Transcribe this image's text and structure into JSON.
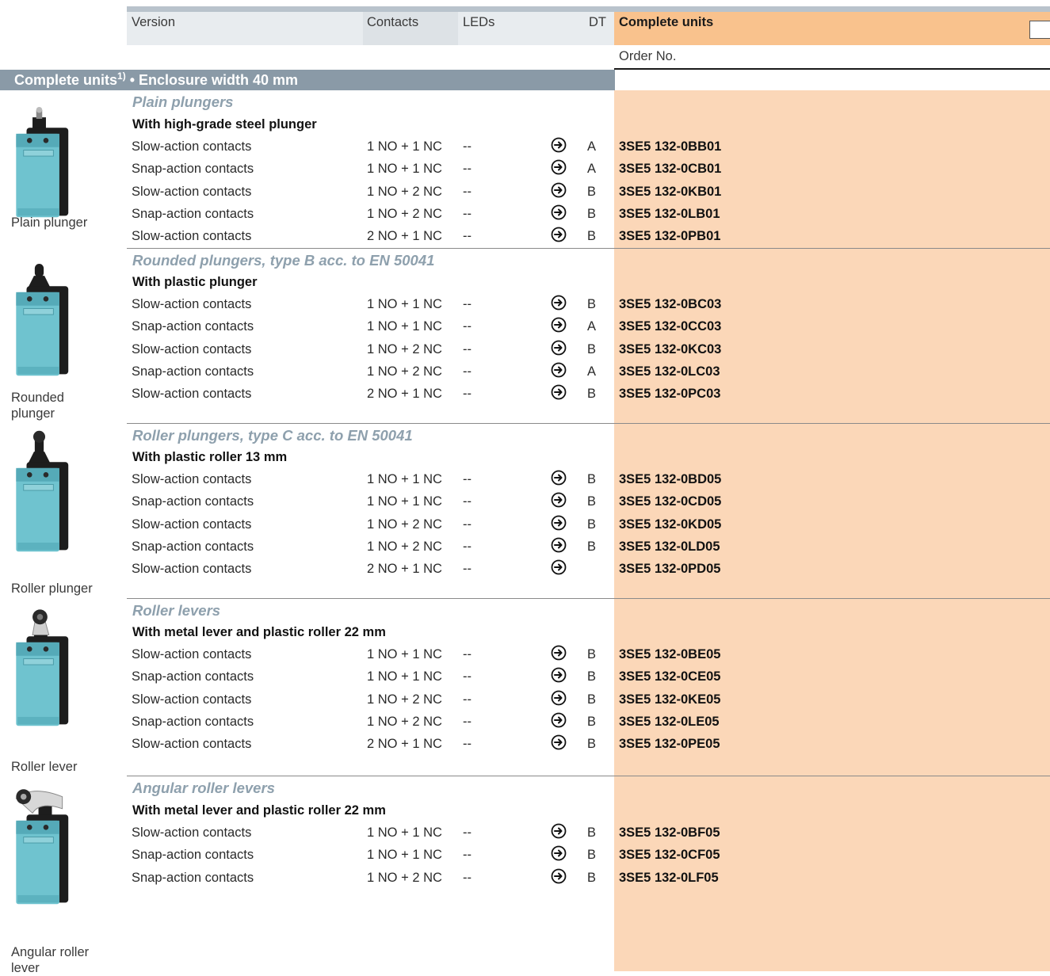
{
  "header": {
    "version": "Version",
    "contacts": "Contacts",
    "leds": "LEDs",
    "dt": "DT",
    "complete_units": "Complete units",
    "order_no": "Order No."
  },
  "section": {
    "title": "Complete units",
    "footnote": "1)",
    "suffix": " • Enclosure width 40 mm"
  },
  "colors": {
    "accent_orange": "#f9c28d",
    "order_bg": "#fbd7b8",
    "section_bg": "#8a9aa7",
    "group_title": "#8ea0ad"
  },
  "groups": [
    {
      "title": "Plain plungers",
      "subtitle": "With high-grade steel plunger",
      "image_label": "Plain plunger",
      "image_icon": "plain-plunger-switch",
      "rows": [
        {
          "version": "Slow-action contacts",
          "contacts": "1 NO + 1 NC",
          "leds": "--",
          "dt": "A",
          "order": "3SE5 132-0BB01"
        },
        {
          "version": "Snap-action contacts",
          "contacts": "1 NO + 1 NC",
          "leds": "--",
          "dt": "A",
          "order": "3SE5 132-0CB01"
        },
        {
          "version": "Slow-action contacts",
          "contacts": "1 NO + 2 NC",
          "leds": "--",
          "dt": "B",
          "order": "3SE5 132-0KB01"
        },
        {
          "version": "Snap-action contacts",
          "contacts": "1 NO + 2 NC",
          "leds": "--",
          "dt": "B",
          "order": "3SE5 132-0LB01"
        },
        {
          "version": "Slow-action contacts",
          "contacts": "2 NO + 1 NC",
          "leds": "--",
          "dt": "B",
          "order": "3SE5 132-0PB01"
        }
      ]
    },
    {
      "title": "Rounded plungers, type B acc. to EN 50041",
      "subtitle": "With plastic plunger",
      "image_label": "Rounded plunger",
      "image_icon": "rounded-plunger-switch",
      "rows": [
        {
          "version": "Slow-action contacts",
          "contacts": "1 NO + 1 NC",
          "leds": "--",
          "dt": "B",
          "order": "3SE5 132-0BC03"
        },
        {
          "version": "Snap-action contacts",
          "contacts": "1 NO + 1 NC",
          "leds": "--",
          "dt": "A",
          "order": "3SE5 132-0CC03"
        },
        {
          "version": "Slow-action contacts",
          "contacts": "1 NO + 2 NC",
          "leds": "--",
          "dt": "B",
          "order": "3SE5 132-0KC03"
        },
        {
          "version": "Snap-action contacts",
          "contacts": "1 NO + 2 NC",
          "leds": "--",
          "dt": "A",
          "order": "3SE5 132-0LC03"
        },
        {
          "version": "Slow-action contacts",
          "contacts": "2 NO + 1 NC",
          "leds": "--",
          "dt": "B",
          "order": "3SE5 132-0PC03"
        }
      ]
    },
    {
      "title": "Roller plungers, type C acc. to EN 50041",
      "subtitle": "With plastic roller 13 mm",
      "image_label": "Roller plunger",
      "image_icon": "roller-plunger-switch",
      "rows": [
        {
          "version": "Slow-action contacts",
          "contacts": "1 NO + 1 NC",
          "leds": "--",
          "dt": "B",
          "order": "3SE5 132-0BD05"
        },
        {
          "version": "Snap-action contacts",
          "contacts": "1 NO + 1 NC",
          "leds": "--",
          "dt": "B",
          "order": "3SE5 132-0CD05"
        },
        {
          "version": "Slow-action contacts",
          "contacts": "1 NO + 2 NC",
          "leds": "--",
          "dt": "B",
          "order": "3SE5 132-0KD05"
        },
        {
          "version": "Snap-action contacts",
          "contacts": "1 NO + 2 NC",
          "leds": "--",
          "dt": "B",
          "order": "3SE5 132-0LD05"
        },
        {
          "version": "Slow-action contacts",
          "contacts": "2 NO + 1 NC",
          "leds": "--",
          "dt": "",
          "order": "3SE5 132-0PD05"
        }
      ]
    },
    {
      "title": "Roller levers",
      "subtitle": "With metal lever and plastic roller 22 mm",
      "image_label": "Roller lever",
      "image_icon": "roller-lever-switch",
      "rows": [
        {
          "version": "Slow-action contacts",
          "contacts": "1 NO + 1 NC",
          "leds": "--",
          "dt": "B",
          "order": "3SE5 132-0BE05"
        },
        {
          "version": "Snap-action contacts",
          "contacts": "1 NO + 1 NC",
          "leds": "--",
          "dt": "B",
          "order": "3SE5 132-0CE05"
        },
        {
          "version": "Slow-action contacts",
          "contacts": "1 NO + 2 NC",
          "leds": "--",
          "dt": "B",
          "order": "3SE5 132-0KE05"
        },
        {
          "version": "Snap-action contacts",
          "contacts": "1 NO + 2 NC",
          "leds": "--",
          "dt": "B",
          "order": "3SE5 132-0LE05"
        },
        {
          "version": "Slow-action contacts",
          "contacts": "2 NO + 1 NC",
          "leds": "--",
          "dt": "B",
          "order": "3SE5 132-0PE05"
        }
      ]
    },
    {
      "title": "Angular roller levers",
      "subtitle": "With metal lever and plastic roller 22 mm",
      "image_label": "Angular roller lever",
      "image_icon": "angular-roller-lever-switch",
      "rows": [
        {
          "version": "Slow-action contacts",
          "contacts": "1 NO + 1 NC",
          "leds": "--",
          "dt": "B",
          "order": "3SE5 132-0BF05"
        },
        {
          "version": "Snap-action contacts",
          "contacts": "1 NO + 1 NC",
          "leds": "--",
          "dt": "B",
          "order": "3SE5 132-0CF05"
        },
        {
          "version": "Snap-action contacts",
          "contacts": "1 NO + 2 NC",
          "leds": "--",
          "dt": "B",
          "order": "3SE5 132-0LF05"
        }
      ]
    }
  ]
}
